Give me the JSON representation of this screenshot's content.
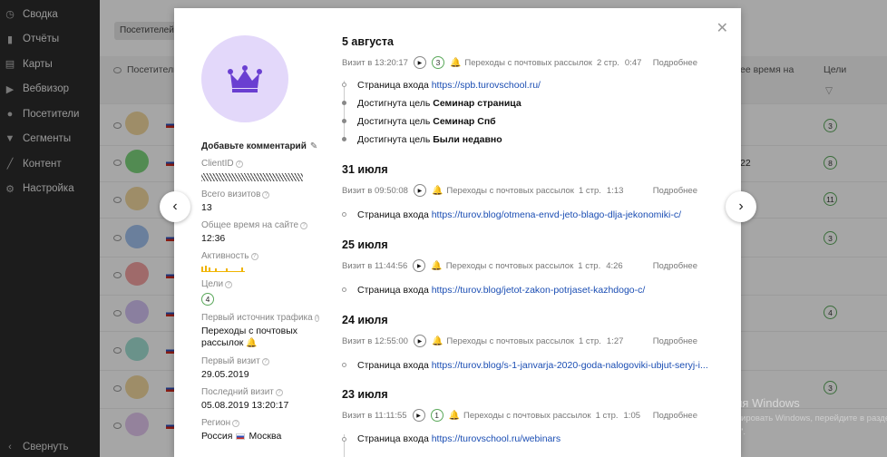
{
  "sidebar": {
    "items": [
      {
        "label": "Сводка",
        "icon": "clock-icon"
      },
      {
        "label": "Отчёты",
        "icon": "chart-icon"
      },
      {
        "label": "Карты",
        "icon": "map-icon"
      },
      {
        "label": "Вебвизор",
        "icon": "play-icon"
      },
      {
        "label": "Посетители",
        "icon": "user-icon"
      },
      {
        "label": "Сегменты",
        "icon": "filter-icon"
      },
      {
        "label": "Контент",
        "icon": "pen-icon"
      },
      {
        "label": "Настройка",
        "icon": "gear-icon"
      }
    ],
    "collapse_label": "Свернуть"
  },
  "background": {
    "filter_label": "Посетителей с",
    "col_visitor": "Посетитель",
    "col_time": "ее время на",
    "col_goals": "Цели",
    "goal_values": [
      "3",
      "8",
      "11",
      "3",
      "4",
      "3"
    ],
    "time_value": "22"
  },
  "modal": {
    "comment_label": "Добавьте комментарий",
    "fields": {
      "client_id_label": "ClientID",
      "total_visits_label": "Всего визитов",
      "total_visits": "13",
      "total_time_label": "Общее время на сайте",
      "total_time": "12:36",
      "activity_label": "Активность",
      "goals_label": "Цели",
      "goals": "4",
      "first_source_label": "Первый источник трафика",
      "first_source": "Переходы с почтовых рассылок",
      "first_visit_label": "Первый визит",
      "first_visit": "29.05.2019",
      "last_visit_label": "Последний визит",
      "last_visit": "05.08.2019 13:20:17",
      "region_label": "Регион",
      "region": "Россия",
      "city": "Москва"
    },
    "days": [
      {
        "title": "5 августа",
        "visit_time": "Визит в 13:20:17",
        "goals": "3",
        "source": "Переходы с почтовых рассылок",
        "pages": "2 стр.",
        "duration": "0:47",
        "more": "Подробнее",
        "entry_label": "Страница входа",
        "entry_url": "https://spb.turovschool.ru/",
        "goal_prefix": "Достигнута цель",
        "goal_events": [
          "Семинар страница",
          "Семинар Спб",
          "Были недавно"
        ]
      },
      {
        "title": "31 июля",
        "visit_time": "Визит в 09:50:08",
        "source": "Переходы с почтовых рассылок",
        "pages": "1 стр.",
        "duration": "1:13",
        "more": "Подробнее",
        "entry_label": "Страница входа",
        "entry_url": "https://turov.blog/otmena-envd-jeto-blago-dlja-jekonomiki-c/"
      },
      {
        "title": "25 июля",
        "visit_time": "Визит в 11:44:56",
        "source": "Переходы с почтовых рассылок",
        "pages": "1 стр.",
        "duration": "4:26",
        "more": "Подробнее",
        "entry_label": "Страница входа",
        "entry_url": "https://turov.blog/jetot-zakon-potrjaset-kazhdogo-c/"
      },
      {
        "title": "24 июля",
        "visit_time": "Визит в 12:55:00",
        "source": "Переходы с почтовых рассылок",
        "pages": "1 стр.",
        "duration": "1:27",
        "more": "Подробнее",
        "entry_label": "Страница входа",
        "entry_url": "https://turov.blog/s-1-janvarja-2020-goda-nalogoviki-ubjut-seryj-i..."
      },
      {
        "title": "23 июля",
        "visit_time": "Визит в 11:11:55",
        "goals": "1",
        "source": "Переходы с почтовых рассылок",
        "pages": "1 стр.",
        "duration": "1:05",
        "more": "Подробнее",
        "entry_label": "Страница входа",
        "entry_url": "https://turovschool.ru/webinars"
      }
    ]
  },
  "watermark": {
    "line1": "Активация Windows",
    "line2": "Чтобы активировать Windows, перейдите в раздел",
    "line3": "\"Параметры\"."
  },
  "colors": {
    "sidebar_bg": "#2b2b2b",
    "avatar_bg": "#e3d8fa",
    "crown": "#6a3fd1",
    "link": "#1a4db3",
    "goal_green": "#5aa85a",
    "bell": "#f0a500"
  }
}
